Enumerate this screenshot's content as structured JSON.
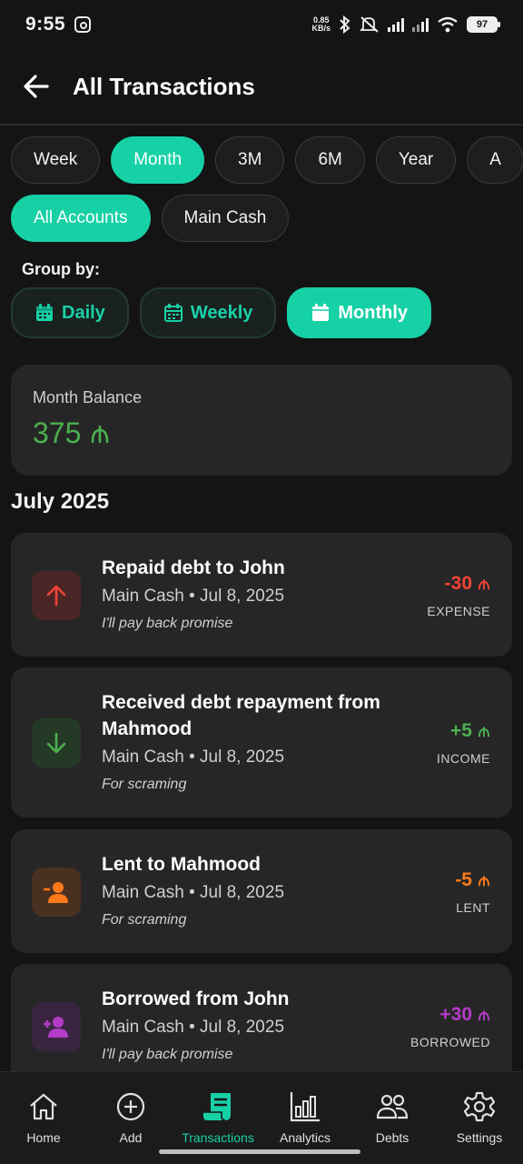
{
  "status": {
    "time": "9:55",
    "net_speed_top": "0.85",
    "net_speed_bottom": "KB/s",
    "battery": "97"
  },
  "header": {
    "title": "All Transactions"
  },
  "periods": [
    {
      "label": "Week",
      "active": false
    },
    {
      "label": "Month",
      "active": true
    },
    {
      "label": "3M",
      "active": false
    },
    {
      "label": "6M",
      "active": false
    },
    {
      "label": "Year",
      "active": false
    },
    {
      "label": "A",
      "active": false
    }
  ],
  "accounts": [
    {
      "label": "All Accounts",
      "active": true
    },
    {
      "label": "Main Cash",
      "active": false
    }
  ],
  "group_by": {
    "label": "Group by:",
    "options": [
      {
        "label": "Daily",
        "active": false
      },
      {
        "label": "Weekly",
        "active": false
      },
      {
        "label": "Monthly",
        "active": true
      }
    ]
  },
  "balance": {
    "label": "Month Balance",
    "value": "375",
    "color": "#4caf50"
  },
  "month_heading": "July 2025",
  "transactions": [
    {
      "title": "Repaid debt to John",
      "account": "Main Cash",
      "date": "Jul 8, 2025",
      "note": "I'll pay back promise",
      "amount": "-30",
      "type": "EXPENSE",
      "color": "#f44336",
      "icon": "arrow-up-icon"
    },
    {
      "title": "Received debt repayment from Mahmood",
      "account": "Main Cash",
      "date": "Jul 8, 2025",
      "note": "For scraming",
      "amount": "+5",
      "type": "INCOME",
      "color": "#4caf50",
      "icon": "arrow-down-icon"
    },
    {
      "title": "Lent to Mahmood",
      "account": "Main Cash",
      "date": "Jul 8, 2025",
      "note": "For scraming",
      "amount": "-5",
      "type": "LENT",
      "color": "#ff7a1a",
      "icon": "person-remove-icon"
    },
    {
      "title": "Borrowed from John",
      "account": "Main Cash",
      "date": "Jul 8, 2025",
      "note": "I'll pay back promise",
      "amount": "+30",
      "type": "BORROWED",
      "color": "#b43cc8",
      "icon": "person-add-icon"
    }
  ],
  "nav": [
    {
      "label": "Home",
      "icon": "home-icon",
      "active": false
    },
    {
      "label": "Add",
      "icon": "add-circle-icon",
      "active": false
    },
    {
      "label": "Transactions",
      "icon": "receipt-icon",
      "active": true
    },
    {
      "label": "Analytics",
      "icon": "bar-chart-icon",
      "active": false
    },
    {
      "label": "Debts",
      "icon": "people-icon",
      "active": false
    },
    {
      "label": "Settings",
      "icon": "gear-icon",
      "active": false
    }
  ],
  "colors": {
    "accent": "#17d1a6",
    "card": "#262626",
    "background": "#141414"
  }
}
